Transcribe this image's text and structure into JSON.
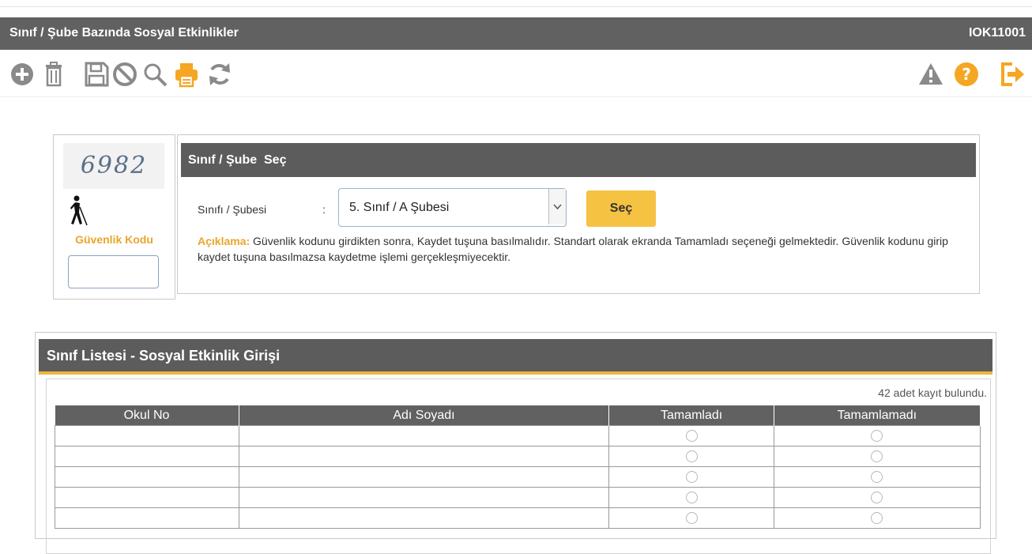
{
  "header": {
    "title": "Sınıf / Şube Bazında Sosyal Etkinlikler",
    "code": "IOK11001"
  },
  "toolbar": {
    "left_icons": [
      "add-icon",
      "delete-icon",
      "save-icon",
      "cancel-icon",
      "search-icon",
      "print-icon",
      "refresh-icon"
    ],
    "right_icons": [
      "warning-icon",
      "help-icon",
      "exit-icon"
    ],
    "accent": "#f5a623",
    "icon_gray": "#8a8a8a"
  },
  "security": {
    "captcha_text": "6982",
    "label": "Güvenlik Kodu",
    "input_value": ""
  },
  "selector": {
    "title": "Sınıf / Şube  Seç",
    "field_label": "Sınıfı / Şubesi",
    "colon": ":",
    "selected_value": "5. Sınıf / A Şubesi",
    "button_label": "Seç",
    "note_label": "Açıklama:",
    "note_text": " Güvenlik kodunu girdikten sonra, Kaydet tuşuna basılmalıdır. Standart olarak ekranda Tamamladı seçeneği gelmektedir. Güvenlik kodunu girip kaydet tuşuna basılmazsa kaydetme işlemi gerçekleşmiyecektir."
  },
  "list": {
    "title": "Sınıf Listesi - Sosyal Etkinlik Girişi",
    "count_text": "42 adet kayıt bulundu.",
    "columns": [
      "Okul No",
      "Adı Soyadı",
      "Tamamladı",
      "Tamamlamadı"
    ],
    "rows": [
      {
        "okul_no": "",
        "adi_soyadi": ""
      },
      {
        "okul_no": "",
        "adi_soyadi": ""
      },
      {
        "okul_no": "",
        "adi_soyadi": ""
      },
      {
        "okul_no": "",
        "adi_soyadi": ""
      },
      {
        "okul_no": "",
        "adi_soyadi": ""
      }
    ]
  }
}
